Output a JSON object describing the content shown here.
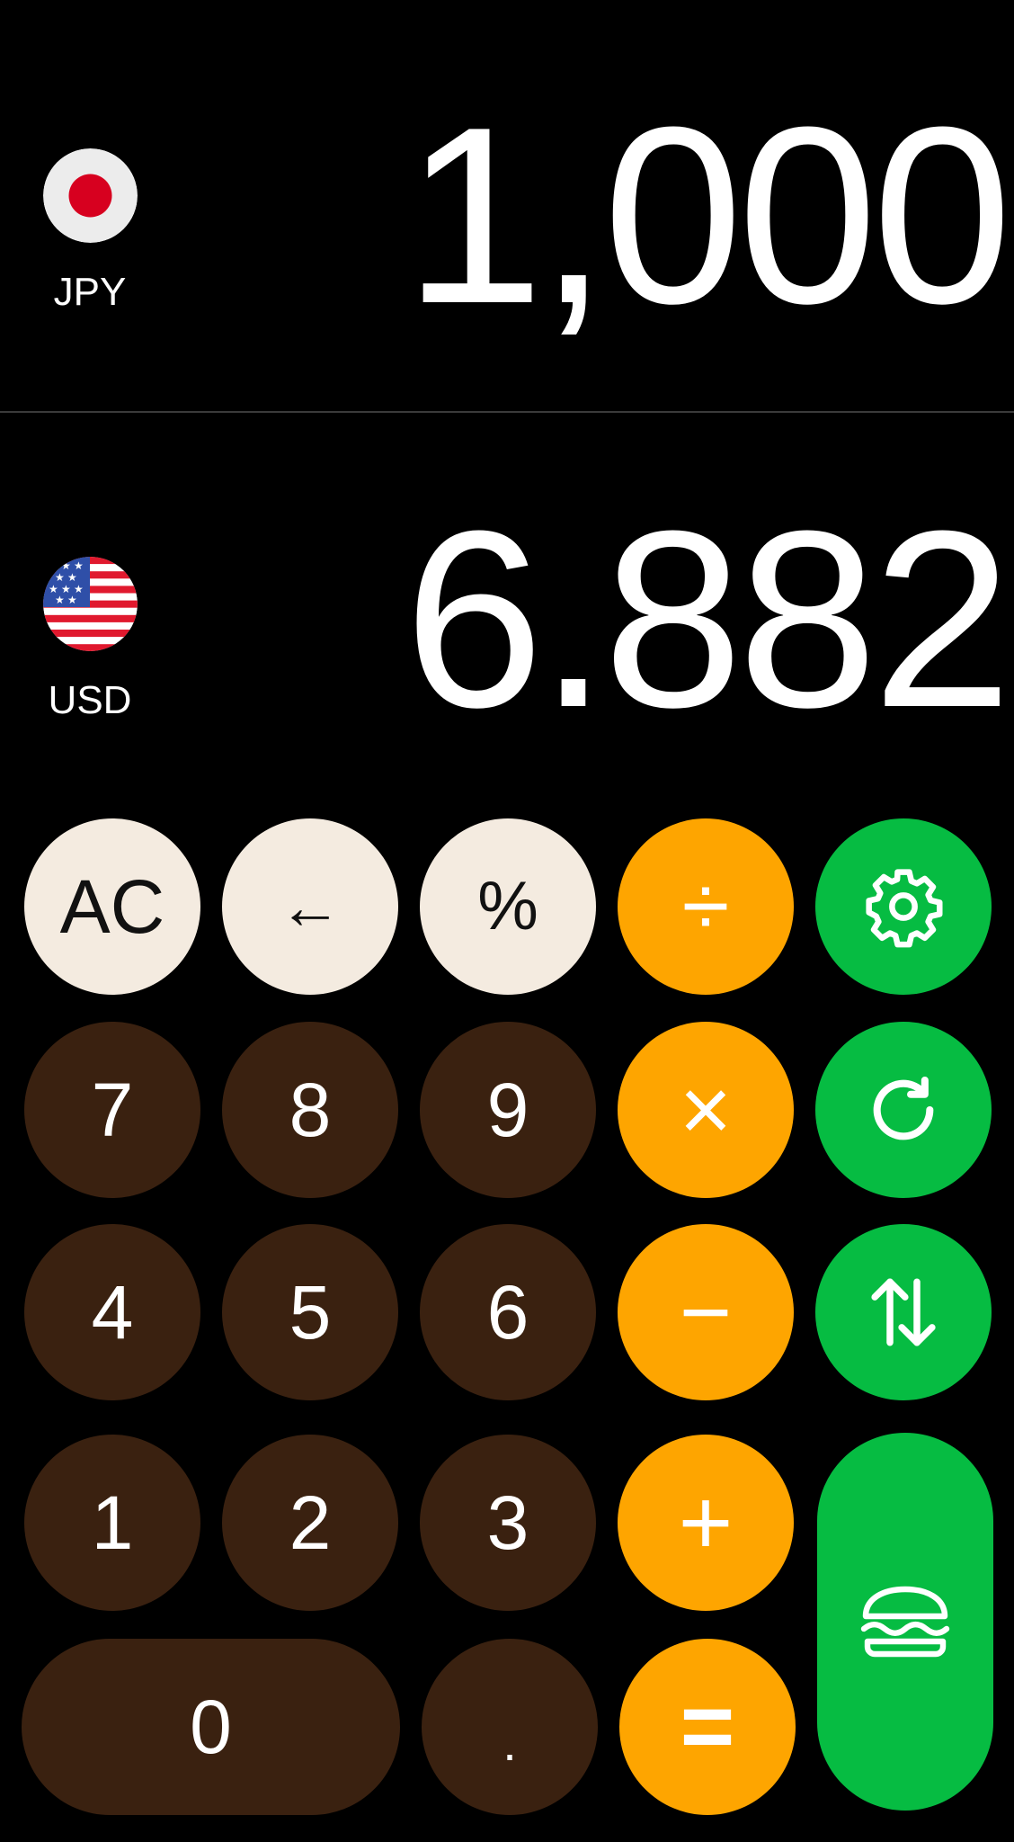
{
  "top": {
    "currency_code": "JPY",
    "amount": "1,000",
    "flag": "japan-flag-icon"
  },
  "bottom": {
    "currency_code": "USD",
    "amount": "6.882",
    "flag": "usa-flag-icon"
  },
  "keys": {
    "ac": "AC",
    "backspace": "←",
    "percent": "%",
    "divide": "÷",
    "settings": "gear-icon",
    "seven": "7",
    "eight": "8",
    "nine": "9",
    "multiply": "×",
    "refresh": "refresh-icon",
    "four": "4",
    "five": "5",
    "six": "6",
    "minus": "−",
    "swap": "swap-arrows-icon",
    "one": "1",
    "two": "2",
    "three": "3",
    "plus": "+",
    "menu": "burger-icon",
    "zero": "0",
    "decimal": ".",
    "equals": "="
  },
  "colors": {
    "background": "#000000",
    "function_key": "#F4EBE0",
    "number_key": "#3A2110",
    "operator_key": "#FEA500",
    "action_key": "#06BC42"
  }
}
